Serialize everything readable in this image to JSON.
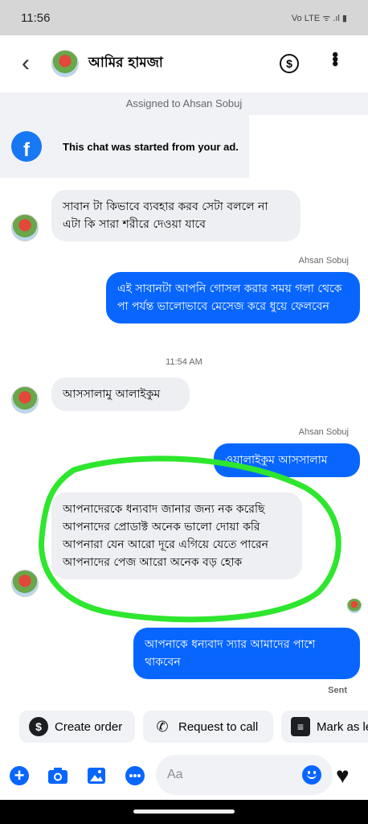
{
  "status_bar": {
    "time": "11:56",
    "indicators": "Vo LTE ᯤ .ıl ▮"
  },
  "header": {
    "contact_name": "আমির হামজা",
    "back_icon": "back-arrow-icon",
    "payment_icon": "dollar-circle-icon",
    "menu_icon": "kebab-menu-icon"
  },
  "assigned_bar": {
    "text": "Assigned to Ahsan Sobuj"
  },
  "ad_banner": {
    "text": "This chat was started from your ad.",
    "icon": "facebook-logo-icon"
  },
  "messages": [
    {
      "direction": "incoming",
      "text": "সাবান টা কিভাবে ব্যবহার করব সেটা বললে না এটা কি সারা শরীরে দেওয়া যাবে"
    },
    {
      "direction": "outgoing",
      "sender": "Ahsan Sobuj",
      "text": "এই সাবানটা আপনি গোসল করার সময় গলা থেকে পা পর্যন্ত ভালোভাবে মেসেজ করে ধুয়ে ফেলবেন"
    },
    {
      "type": "timestamp",
      "text": "11:54 AM"
    },
    {
      "direction": "incoming",
      "text": "আসসালামু আলাইকুম"
    },
    {
      "direction": "outgoing",
      "sender": "Ahsan Sobuj",
      "text": "ওয়ালাইকুম আসসালাম"
    },
    {
      "direction": "incoming",
      "text": "আপনাদেরকে ধন্যবাদ জানার জন্য নক করেছি আপনাদের প্রোডাক্ট অনেক ভালো দোয়া করি আপনারা যেন আরো দূরে এগিয়ে যেতে পারেন আপনাদের পেজ আরো অনেক বড় হোক"
    },
    {
      "direction": "outgoing",
      "text": "আপনাকে ধন্যবাদ স্যার আমাদের পাশে থাকবেন"
    }
  ],
  "delivery_status": "Sent",
  "quick_actions": [
    {
      "label": "Create order",
      "icon": "dollar-icon"
    },
    {
      "label": "Request to call",
      "icon": "phone-add-icon"
    },
    {
      "label": "Mark as lead",
      "icon": "contact-card-icon"
    }
  ],
  "composer": {
    "placeholder": "Aa",
    "value": ""
  },
  "colors": {
    "accent": "#0866ff",
    "incoming_bubble": "#eeeff2",
    "annotation": "#2ee62e"
  }
}
